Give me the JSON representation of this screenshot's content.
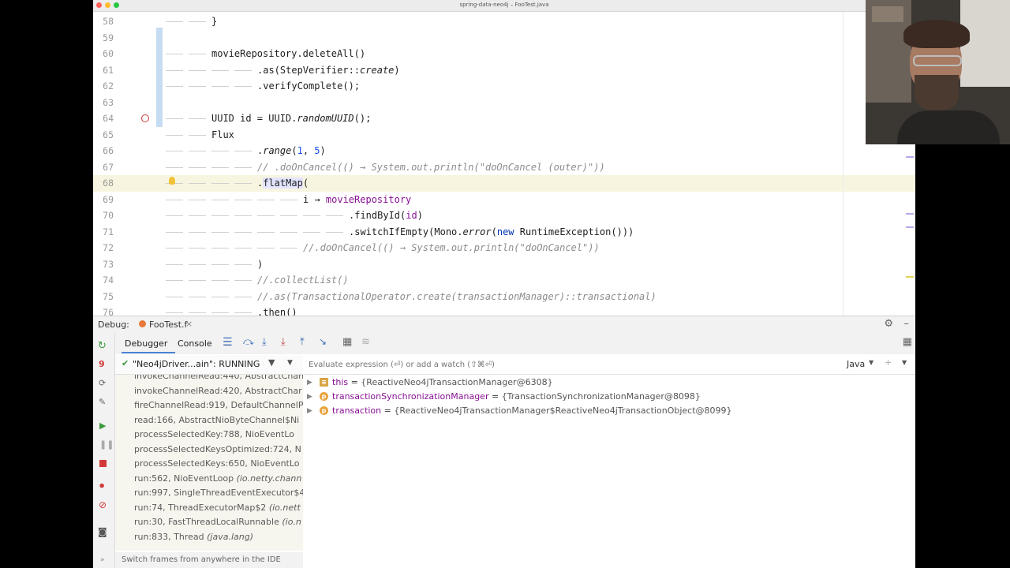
{
  "window": {
    "title": "spring-data-neo4j – FooTest.java"
  },
  "editor": {
    "lines": [
      {
        "n": "58",
        "indent": 2,
        "html": "}"
      },
      {
        "n": "59",
        "indent": 0,
        "html": ""
      },
      {
        "n": "60",
        "indent": 2,
        "html": "movieRepository.deleteAll()"
      },
      {
        "n": "61",
        "indent": 4,
        "html": ".as(StepVerifier::<span class='it'>create</span>)"
      },
      {
        "n": "62",
        "indent": 4,
        "html": ".verifyComplete();"
      },
      {
        "n": "63",
        "indent": 0,
        "html": ""
      },
      {
        "n": "64",
        "indent": 2,
        "html": "UUID id = UUID.<span class='it'>randomUUID</span>();"
      },
      {
        "n": "65",
        "indent": 2,
        "html": "Flux"
      },
      {
        "n": "66",
        "indent": 4,
        "html": ".<span class='it'>range</span>(<span class='num'>1</span>, <span class='num'>5</span>)"
      },
      {
        "n": "67",
        "indent": 4,
        "html": "<span class='cm'>// .doOnCancel(() → System.out.println(\"doOnCancel (outer)\"))</span>"
      },
      {
        "n": "68",
        "indent": 4,
        "html": ".<span class='hl'>flatMap</span>("
      },
      {
        "n": "69",
        "indent": 6,
        "html": "i → <span class='fld'>movieRepository</span>"
      },
      {
        "n": "70",
        "indent": 8,
        "html": ".findById(<span class='fld'>id</span>)"
      },
      {
        "n": "71",
        "indent": 8,
        "html": ".switchIfEmpty(Mono.<span class='it'>error</span>(<span class='kw'>new</span> RuntimeException()))"
      },
      {
        "n": "72",
        "indent": 6,
        "html": "<span class='cm'>//.doOnCancel(() → System.out.println(\"doOnCancel\"))</span>"
      },
      {
        "n": "73",
        "indent": 4,
        "html": ")"
      },
      {
        "n": "74",
        "indent": 4,
        "html": "<span class='cm'>//.collectList()</span>"
      },
      {
        "n": "75",
        "indent": 4,
        "html": "<span class='cm'>//.as(TransactionalOperator.create(transactionManager)::transactional)</span>"
      },
      {
        "n": "76",
        "indent": 4,
        "html": ".then()"
      }
    ]
  },
  "debug": {
    "label": "Debug:",
    "tab_name": "FooTest.f",
    "tabs": [
      "Debugger",
      "Console"
    ],
    "thread": "\"Neo4jDriver...ain\": RUNNING",
    "watch_placeholder": "Evaluate expression (⏎) or add a watch (⇧⌘⏎)",
    "language": "Java",
    "frames": [
      {
        "method": "invokeChannelRead:440, AbstractChan",
        "pkg": ""
      },
      {
        "method": "invokeChannelRead:420, AbstractChar",
        "pkg": ""
      },
      {
        "method": "fireChannelRead:919, DefaultChannelP",
        "pkg": ""
      },
      {
        "method": "read:166, AbstractNioByteChannel$Ni",
        "pkg": ""
      },
      {
        "method": "processSelectedKey:788, NioEventLo",
        "pkg": ""
      },
      {
        "method": "processSelectedKeysOptimized:724, N",
        "pkg": ""
      },
      {
        "method": "processSelectedKeys:650, NioEventLo",
        "pkg": ""
      },
      {
        "method": "run:562, NioEventLoop ",
        "pkg": "(io.netty.chann"
      },
      {
        "method": "run:997, SingleThreadEventExecutor$4",
        "pkg": ""
      },
      {
        "method": "run:74, ThreadExecutorMap$2 ",
        "pkg": "(io.nett"
      },
      {
        "method": "run:30, FastThreadLocalRunnable ",
        "pkg": "(io.n"
      },
      {
        "method": "run:833, Thread ",
        "pkg": "(java.lang)"
      }
    ],
    "variables": [
      {
        "name": "this",
        "value": "{ReactiveNeo4jTransactionManager@6308}",
        "icon": "field"
      },
      {
        "name": "transactionSynchronizationManager",
        "value": "{TransactionSynchronizationManager@8098}",
        "icon": "p"
      },
      {
        "name": "transaction",
        "value": "{ReactiveNeo4jTransactionManager$ReactiveNeo4jTransactionObject@8099}",
        "icon": "p"
      }
    ],
    "status_hint": "Switch frames from anywhere in the IDE with..."
  }
}
